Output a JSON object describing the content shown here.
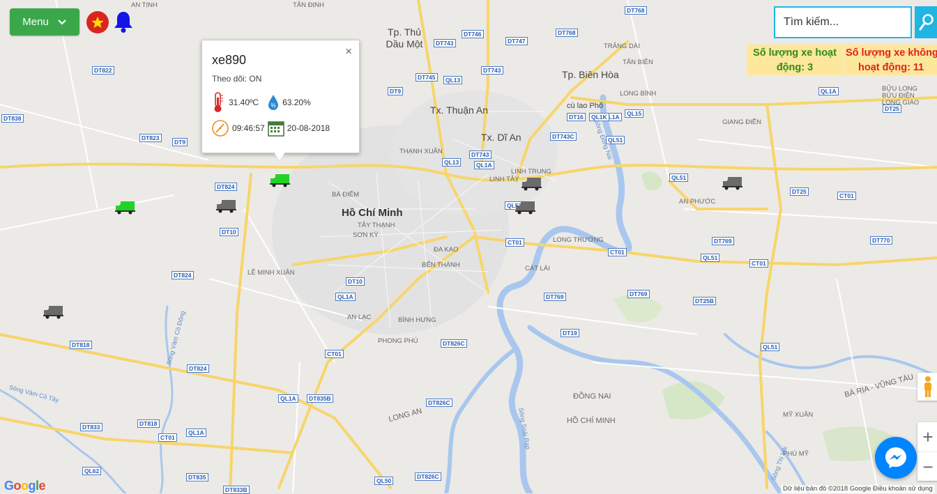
{
  "menu": {
    "label": "Menu"
  },
  "popup": {
    "title": "xe890",
    "follow": "Theo dõi: ON",
    "temperature": "31.40ºC",
    "humidity": "63.20%",
    "time": "09:46:57",
    "date": "20-08-2018",
    "close": "×"
  },
  "search": {
    "placeholder": "Tìm kiếm..."
  },
  "stats": {
    "active_line1": "Số lượng xe hoạt",
    "active_line2": "động: 3",
    "inactive_line1": "Số lượng xe không",
    "inactive_line2": "hoạt động: 11"
  },
  "zoom": {
    "plus": "+",
    "minus": "−"
  },
  "footer": {
    "google": "Google",
    "attribution": "Dữ liệu bản đồ ©2018 Google    Điều khoản sử dụng"
  },
  "map": {
    "cities": [
      "Hồ Chí Minh",
      "Tp. Biên Hòa",
      "Tp. Thủ Dầu Một",
      "Tx. Thuận An",
      "Tx. Dĩ An"
    ],
    "districts": [
      "AN TỊNH",
      "TÂN ĐỊNH",
      "BÀ ĐIỂM",
      "TÂY THẠNH",
      "SƠN KỲ",
      "ĐA KAO",
      "BẾN THÀNH",
      "AN LẠC",
      "BÌNH HƯNG",
      "PHONG PHÚ",
      "LÊ MINH XUÂN",
      "THẠNH XUÂN",
      "LINH TRUNG",
      "LINH TÂY",
      "LONG TRƯỜNG",
      "CÁT LÁI",
      "AN PHƯỚC",
      "GIANG ĐIỀN",
      "LONG BÌNH",
      "TRẢNG DÀI",
      "TÂN BIÊN",
      "BỬU LONG",
      "BỬU ĐIỆN",
      "LONG GIAO",
      "ĐỒNG NAI",
      "HỒ CHÍ MINH",
      "LONG AN",
      "MỸ XUÂN",
      "PHÚ MỸ",
      "BÀ RỊA - VŨNG TÀU",
      "cù lao Phố",
      "Sông Đồng Nai",
      "Sông Vàm Cỏ Đông",
      "Sông Vàm Cỏ Tây",
      "Sông Soài Rạp",
      "Sông Thị Vải"
    ],
    "roads": [
      "DT768",
      "DT746",
      "DT768",
      "DT747",
      "DT743",
      "DT745",
      "QL13",
      "DT743",
      "QL1A",
      "DT9",
      "DT822",
      "DT838",
      "DT823",
      "DT9",
      "DT824",
      "DT10",
      "DT824",
      "DT818",
      "DT824",
      "DT818",
      "DT833",
      "CT01",
      "QL1A",
      "QL62",
      "DT835",
      "DT833B",
      "QL50",
      "DT826C",
      "DT826C",
      "DT835B",
      "QL1A",
      "CT01",
      "DT826C",
      "DT10",
      "QL1A",
      "QL13",
      "DT743",
      "QL1A",
      "QL52",
      "CT01",
      "CT01",
      "DT769",
      "DT769",
      "DT19",
      "QL51",
      "DT769",
      "DT25B",
      "QL51",
      "CT01",
      "QL51",
      "DT25",
      "DT770",
      "CT01",
      "DT25",
      "QL1A",
      "DT743C",
      "QL15",
      "QL1K",
      "DT16",
      "QL51"
    ]
  }
}
